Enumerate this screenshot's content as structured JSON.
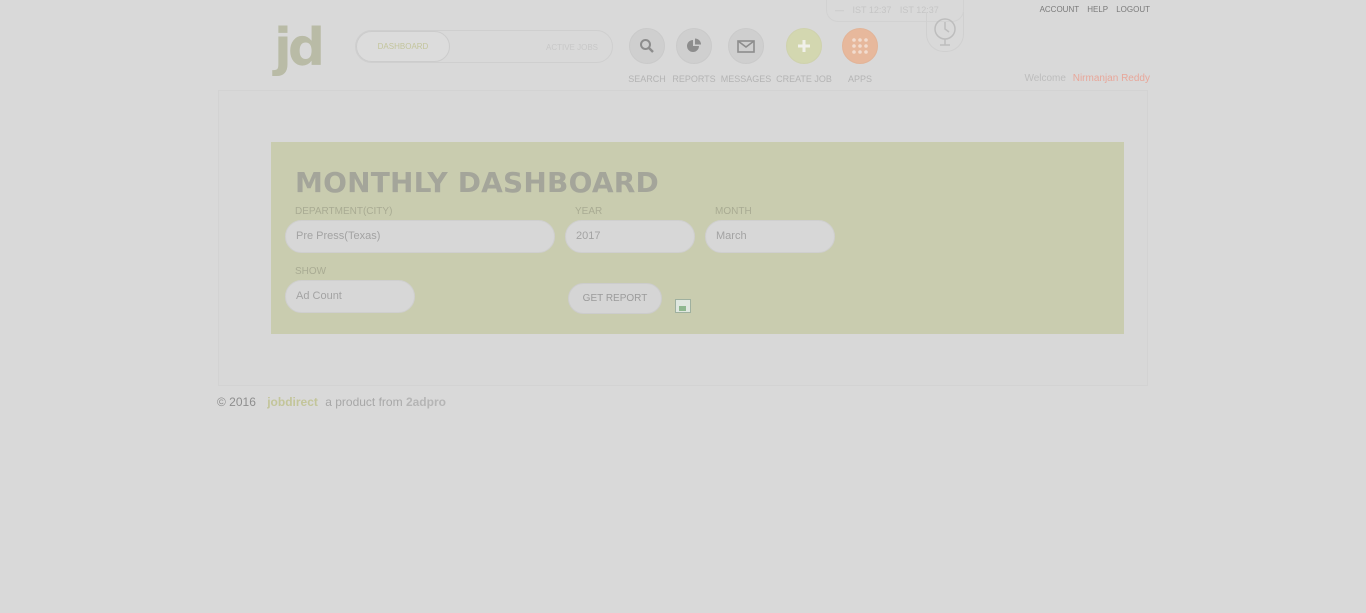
{
  "header": {
    "logo": "jd",
    "tabs": {
      "dashboard": "DASHBOARD",
      "active_jobs": "ACTIVE JOBS"
    },
    "nav": [
      {
        "label": "SEARCH"
      },
      {
        "label": "REPORTS"
      },
      {
        "label": "MESSAGES"
      },
      {
        "label": "CREATE JOB"
      },
      {
        "label": "APPS"
      }
    ],
    "clocks": [
      "IST 12:37",
      "IST 12:37"
    ],
    "links": {
      "account": "ACCOUNT",
      "help": "HELP",
      "logout": "LOGOUT"
    },
    "welcome": "Welcome",
    "user_name": "Nirmanjan Reddy",
    "colors": {
      "create_job": "#d3d7b0",
      "apps": "#e7b89c"
    }
  },
  "dashboard": {
    "title": "MONTHLY DASHBOARD",
    "department_label": "DEPARTMENT(CITY)",
    "department_value": "Pre Press(Texas)",
    "year_label": "YEAR",
    "year_value": "2017",
    "month_label": "MONTH",
    "month_value": "March",
    "show_label": "SHOW",
    "show_value": "Ad Count",
    "get_report": "GET REPORT"
  },
  "footer": {
    "copyright": "© 2016",
    "brand": "jobdirect",
    "tagline": "a product from",
    "brand2": "2adpro"
  }
}
